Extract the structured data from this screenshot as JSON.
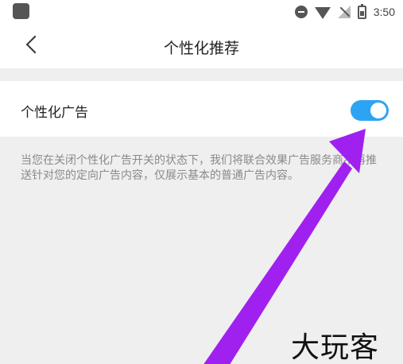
{
  "status_bar": {
    "time": "3:50",
    "icons": [
      "app-notification-icon",
      "do-not-disturb-icon",
      "wifi-icon",
      "no-signal-icon",
      "battery-icon"
    ]
  },
  "header": {
    "title": "个性化推荐",
    "back_icon": "chevron-left-icon"
  },
  "setting": {
    "label": "个性化广告",
    "enabled": true,
    "toggle_color": "#2da4f3"
  },
  "description": "当您在关闭个性化广告开关的状态下，我们将联合效果广告服务商不再推送针对您的定向广告内容，仅展示基本的普通广告内容。",
  "annotation": {
    "arrow_color": "#a020f0"
  },
  "watermark": "大玩客"
}
